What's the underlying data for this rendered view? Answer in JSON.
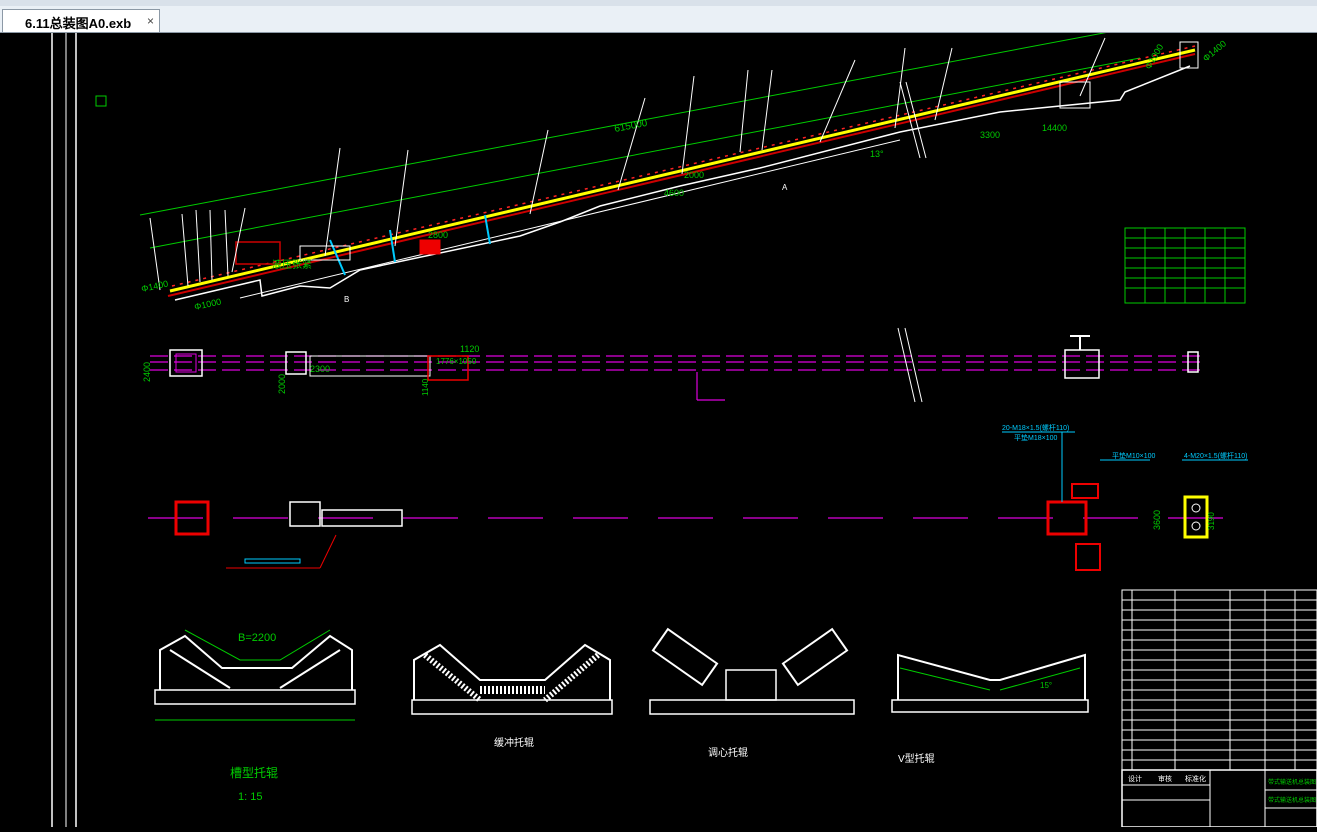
{
  "document_tab": {
    "title": "6.11总装图A0.exb",
    "close_glyph": "×"
  },
  "drawing": {
    "upper_dims": {
      "d1": "Φ1400",
      "d2": "Φ1000",
      "total_length": "615000",
      "d3": "Φ1000",
      "d4": "Φ1400",
      "angle": "13°",
      "len_3300": "3300",
      "len_14400": "14400",
      "len_2000": "2000",
      "len_2800": "2800",
      "len_4600": "4600",
      "label_tension": "液压张紧",
      "leader_a": "A",
      "leader_b": "B"
    },
    "plan_view": {
      "width_2400": "2400",
      "width_2000": "2000",
      "len_2300": "2300",
      "dim_1120": "1120",
      "dim_chute": "1776×1050",
      "dim_1140": "1140",
      "t_mark": "T"
    },
    "detail": {
      "note1": "20-M18×1.5(螺杆110)",
      "note2": "平垫M18×100",
      "note3": "平垫M10×100",
      "note4": "4-M20×1.5(螺杆110)",
      "dim_3600": "3600",
      "dim_3190": "3190"
    },
    "idlers": {
      "trough_width": "B=2200",
      "trough_title": "槽型托辊",
      "trough_scale": "1:  15",
      "buffer_title": "缓冲托辊",
      "align_title": "调心托辊",
      "v_title": "V型托辊",
      "v_angle": "15°"
    },
    "title_block": {
      "project": "带式输送机总装图",
      "name": "带式输送机总装图",
      "cell1": "设计",
      "cell2": "审核",
      "cell3": "标准化"
    }
  }
}
